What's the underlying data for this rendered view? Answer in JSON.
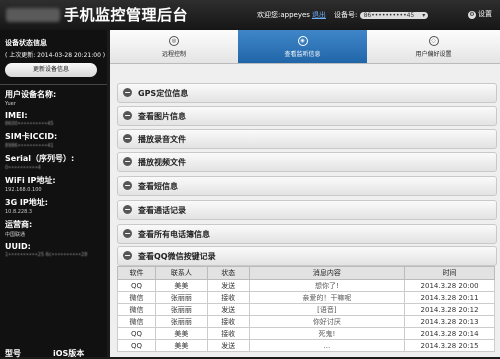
{
  "header": {
    "app_title": "手机监控管理后台",
    "welcome_label": "欢迎您:appeyes",
    "logout_label": "退出",
    "device_label": "设备号:",
    "device_value": "86••••••••••45",
    "settings_label": "设置"
  },
  "sidebar": {
    "status_title": "设备状态信息",
    "last_update": "( 上次更新: 2014-03-28 20:21:00 )",
    "update_button": "更新设备信息",
    "fields": [
      {
        "label": "用户设备名称:",
        "value": "Yuer"
      },
      {
        "label": "IMEI:",
        "value": "8600••••••••••45"
      },
      {
        "label": "SIM卡ICCID:",
        "value": "8986••••••••••41"
      },
      {
        "label": "Serial（序列号）:",
        "value": "0••••••••••4"
      },
      {
        "label": "WiFi IP地址:",
        "value": "192.168.0.100"
      },
      {
        "label": "3G IP地址:",
        "value": "10.8.228.3"
      },
      {
        "label": "运营商:",
        "value": "中国联通"
      },
      {
        "label": "UUID:",
        "value": "1••••••••••25 6c••••••••••28"
      }
    ],
    "footer_left": "型号",
    "footer_right": "iOS版本"
  },
  "tabs": [
    {
      "label": "远程控制",
      "icon": "remote-icon"
    },
    {
      "label": "查看监听信息",
      "icon": "monitor-icon",
      "active": true
    },
    {
      "label": "用户偏好设置",
      "icon": "preferences-icon"
    }
  ],
  "sections": [
    "GPS定位信息",
    "查看图片信息",
    "播放录音文件",
    "播放视频文件",
    "查看短信息",
    "查看通话记录",
    "查看所有电话簿信息",
    "查看QQ微信按键记录"
  ],
  "log_table": {
    "headers": [
      "软件",
      "联系人",
      "状态",
      "消息内容",
      "时间"
    ],
    "rows": [
      [
        "QQ",
        "美美",
        "发送",
        "想你了!",
        "2014.3.28 20:00"
      ],
      [
        "微信",
        "张丽丽",
        "接收",
        "亲爱的！干嘛呢",
        "2014.3.28 20:11"
      ],
      [
        "微信",
        "张丽丽",
        "发送",
        "[语音]",
        "2014.3.28 20:12"
      ],
      [
        "微信",
        "张丽丽",
        "接收",
        "你好讨厌",
        "2014.3.28 20:13"
      ],
      [
        "QQ",
        "美美",
        "接收",
        "死鬼!",
        "2014.3.28 20:14"
      ],
      [
        "QQ",
        "美美",
        "发送",
        "…",
        "2014.3.28 20:15"
      ]
    ]
  },
  "colors": {
    "topbar": "#1b1b1b",
    "active_tab": "#2d74b8",
    "accent_link": "#6fb0ff"
  }
}
